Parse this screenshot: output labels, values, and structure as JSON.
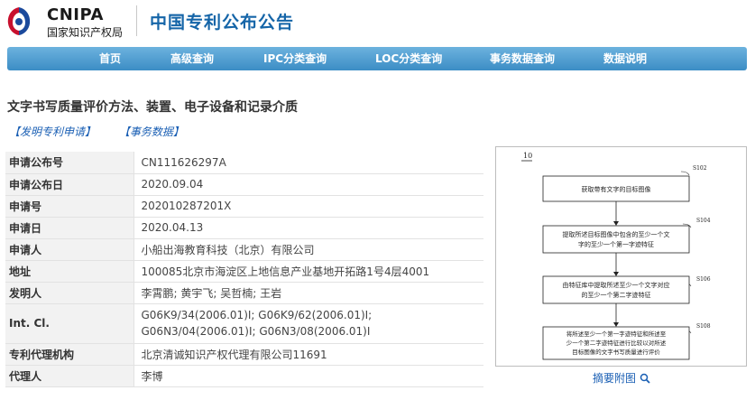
{
  "header": {
    "logo_en": "CNIPA",
    "logo_cn": "国家知识产权局",
    "site_title": "中国专利公布公告"
  },
  "nav": {
    "items": [
      {
        "label": "首页"
      },
      {
        "label": "高级查询"
      },
      {
        "label": "IPC分类查询"
      },
      {
        "label": "LOC分类查询"
      },
      {
        "label": "事务数据查询"
      },
      {
        "label": "数据说明"
      }
    ]
  },
  "document": {
    "title": "文字书写质量评价方法、装置、电子设备和记录介质",
    "tags": [
      "【发明专利申请】",
      "【事务数据】"
    ]
  },
  "fields": [
    {
      "label": "申请公布号",
      "value": "CN111626297A"
    },
    {
      "label": "申请公布日",
      "value": "2020.09.04"
    },
    {
      "label": "申请号",
      "value": "202010287201X"
    },
    {
      "label": "申请日",
      "value": "2020.04.13"
    },
    {
      "label": "申请人",
      "value": "小船出海教育科技（北京）有限公司"
    },
    {
      "label": "地址",
      "value": "100085北京市海淀区上地信息产业基地开拓路1号4层4001"
    },
    {
      "label": "发明人",
      "value": "李霄鹏; 黄宇飞; 吴哲楠; 王岩"
    },
    {
      "label": "Int. Cl.",
      "value": "G06K9/34(2006.01)I; G06K9/62(2006.01)I; G06N3/04(2006.01)I; G06N3/08(2006.01)I"
    },
    {
      "label": "专利代理机构",
      "value": "北京清诚知识产权代理有限公司11691"
    },
    {
      "label": "代理人",
      "value": "李博"
    }
  ],
  "figure": {
    "label": "10",
    "steps": [
      {
        "id": "S102",
        "text_lines": [
          "获取带有文字的目标图像"
        ]
      },
      {
        "id": "S104",
        "text_lines": [
          "提取所述目标图像中包含的至少一个文",
          "字的至少一个第一字迹特征"
        ]
      },
      {
        "id": "S106",
        "text_lines": [
          "由特征库中提取所述至少一个文字对应",
          "的至少一个第二字迹特征"
        ]
      },
      {
        "id": "S108",
        "text_lines": [
          "将所述至少一个第一字迹特征和所述至",
          "少一个第二字迹特征进行比较以对所述",
          "目标图像的文字书写质量进行评价"
        ]
      }
    ],
    "link_label": "摘要附图"
  },
  "colors": {
    "nav_bg": "#4a9bd1",
    "title_blue": "#1565a8",
    "link_blue": "#1a5fb4"
  }
}
